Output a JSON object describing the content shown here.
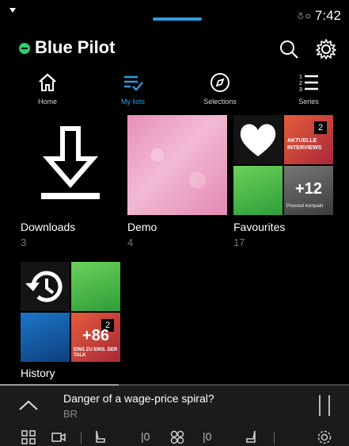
{
  "status_bar": {
    "icons": "☃○",
    "time": "7:42"
  },
  "header": {
    "title": "Blue Pilot",
    "search_icon": "search-icon",
    "settings_icon": "gear-icon"
  },
  "tabs": [
    {
      "label": "Home",
      "icon": "home-icon"
    },
    {
      "label": "My lists",
      "icon": "list-check-icon",
      "active": true
    },
    {
      "label": "Selections",
      "icon": "compass-icon"
    },
    {
      "label": "Series",
      "icon": "numbered-list-icon"
    }
  ],
  "lists": [
    {
      "label": "Downloads",
      "count": "3"
    },
    {
      "label": "Demo",
      "count": "4"
    },
    {
      "label": "Favourites",
      "count": "17",
      "thumb_texts": [
        "2",
        "AKTUELLE INTERVIEWS",
        "+12",
        "Pressed kompakt"
      ]
    },
    {
      "label": "History",
      "thumb_texts": [
        "2",
        "+86",
        "EINS ZU EINS. DER TALK"
      ]
    }
  ],
  "player": {
    "title": "Danger of a wage-price spiral?",
    "source": "BR"
  },
  "taskbar": {
    "seat_left": "|0",
    "seat_right": "|0"
  },
  "colors": {
    "accent": "#2f9be0",
    "logo": "#2ecc71",
    "background": "#000000"
  }
}
